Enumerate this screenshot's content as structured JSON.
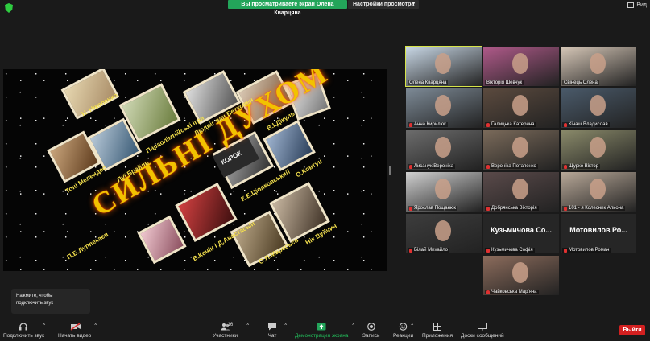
{
  "banner": {
    "share_text": "Вы просматриваете экран Олена Кварцяна",
    "view_options": "Настройки просмотра",
    "view_label": "Вид"
  },
  "slide": {
    "title": "СИЛЬНІ ДУХОМ",
    "captions": [
      "Н. Ніколенко",
      "Параолімпійські ігри",
      "Людвіг ван Бетховен",
      "В.І.Дікуль",
      "Тоні Мелендес",
      "Луї Брайль",
      "О.Ковтун",
      "К.Е.Ціолковський",
      "П.Б.Луппекаєв",
      "В.Кочін і Д.Анастасьїн",
      "О.П.Маресьєв",
      "Нік Вуйчич"
    ],
    "book_label": "КОРОК"
  },
  "participants": [
    {
      "name": "Олена Кварцяна",
      "active": true
    },
    {
      "name": "Вікторія Шевчук"
    },
    {
      "name": "Свінець Олена"
    },
    {
      "name": "Анна Кирилюк",
      "muted": true
    },
    {
      "name": "Галицька Катерина",
      "muted": true
    },
    {
      "name": "Кінаш Владислав",
      "muted": true
    },
    {
      "name": "Лисанук Вероніка",
      "muted": true
    },
    {
      "name": "Вероніка Потапенко",
      "muted": true
    },
    {
      "name": "Щурко Віктор",
      "muted": true
    },
    {
      "name": "Ярослав Пощанюк",
      "muted": true
    },
    {
      "name": "Добрянська Вікторія",
      "muted": true
    },
    {
      "name": "101 - я Колесник Альона",
      "muted": true
    },
    {
      "name": "Білай Михайло",
      "muted": true
    },
    {
      "name": "Кузьмичова Софія",
      "muted": true,
      "big": "Кузьмичова Со..."
    },
    {
      "name": "Мотовилов Роман",
      "muted": true,
      "big": "Мотовилов Ро..."
    },
    {
      "name": "Чайковська Мар'яна",
      "muted": true
    }
  ],
  "audio_note": {
    "line1": "Нажмите, чтобы",
    "line2": "подключить звук"
  },
  "toolbar": {
    "audio": "Подключить звук",
    "video": "Начать видео",
    "participants": "Участники",
    "participants_count": "16",
    "chat": "Чат",
    "share": "Демонстрация экрана",
    "record": "Запись",
    "reactions": "Реакции",
    "apps": "Приложения",
    "whiteboard": "Доски сообщений",
    "end": "Выйти"
  },
  "colors": {
    "accent_green": "#23a55a",
    "end_red": "#d32020",
    "title_gold": "#f2c200"
  }
}
